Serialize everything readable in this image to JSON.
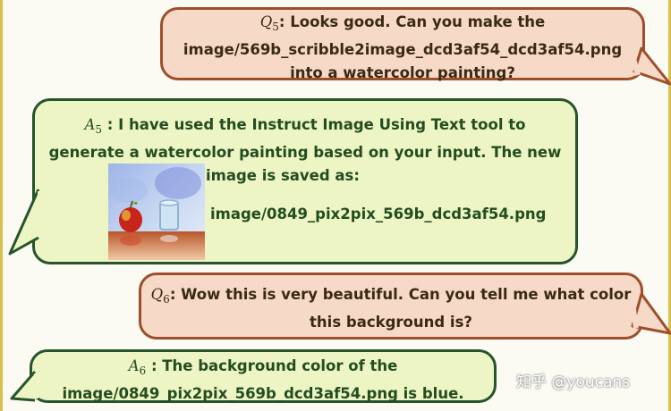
{
  "q5": {
    "label_sym": "Q",
    "label_sub": "5",
    "text_1": ": Looks good. Can you make the",
    "text_2": "image/569b_scribble2image_dcd3af54_dcd3af54.png",
    "text_3": "into a watercolor painting?"
  },
  "a5": {
    "label_sym": "A",
    "label_sub": "5",
    "text_1": " : I have used the Instruct Image Using Text tool to",
    "text_2": "generate a watercolor painting based on your input. The new",
    "text_3": "image is saved as:",
    "filename": "image/0849_pix2pix_569b_dcd3af54.png"
  },
  "q6": {
    "label_sym": "Q",
    "label_sub": "6",
    "text_1": ": Wow this is very beautiful. Can you tell me what color",
    "text_2": "this background is?"
  },
  "a6": {
    "label_sym": "A",
    "label_sub": "6",
    "text_1": " : The background color of the",
    "text_2": "image/0849_pix2pix_569b_dcd3af54.png is blue."
  },
  "watermark": "知乎 @youcans",
  "colors": {
    "question_bg": "#f7d9c8",
    "question_border": "#9d4f2c",
    "answer_bg": "#edf5c5",
    "answer_border": "#27542a"
  }
}
